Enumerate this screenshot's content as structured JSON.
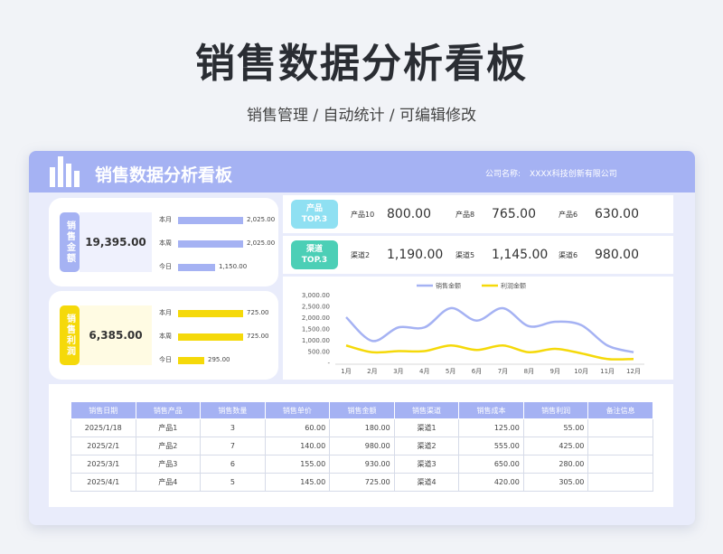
{
  "hero": {
    "title": "销售数据分析看板",
    "subtitle": "销售管理 / 自动统计 / 可编辑修改"
  },
  "header": {
    "title": "销售数据分析看板",
    "company_label": "公司名称:",
    "company_name": "XXXX科技创新有限公司",
    "logo_icon": "bar-chart-icon"
  },
  "kpis": [
    {
      "tag": "销售金额",
      "value": "19,395.00",
      "tag_color": "#a5b2f3",
      "box_color": "#eff1fd",
      "bar_color": "#a5b2f3",
      "bars": [
        {
          "label": "本月",
          "value": "2,025.00",
          "fraction": 1.0
        },
        {
          "label": "本周",
          "value": "2,025.00",
          "fraction": 1.0
        },
        {
          "label": "今日",
          "value": "1,150.00",
          "fraction": 0.568
        }
      ]
    },
    {
      "tag": "销售利润",
      "value": "6,385.00",
      "tag_color": "#f5d90a",
      "box_color": "#fffbe3",
      "bar_color": "#f5d90a",
      "bars": [
        {
          "label": "本月",
          "value": "725.00",
          "fraction": 1.0
        },
        {
          "label": "本周",
          "value": "725.00",
          "fraction": 1.0
        },
        {
          "label": "今日",
          "value": "295.00",
          "fraction": 0.407
        }
      ]
    }
  ],
  "rankings": [
    {
      "tag_line1": "产品",
      "tag_line2": "TOP.3",
      "tag_color": "#8fe0f2",
      "items": [
        {
          "name": "产品10",
          "value": "800.00"
        },
        {
          "name": "产品8",
          "value": "765.00"
        },
        {
          "name": "产品6",
          "value": "630.00"
        }
      ]
    },
    {
      "tag_line1": "渠道",
      "tag_line2": "TOP.3",
      "tag_color": "#4ccfb6",
      "items": [
        {
          "name": "渠道2",
          "value": "1,190.00"
        },
        {
          "name": "渠道5",
          "value": "1,145.00"
        },
        {
          "name": "渠道6",
          "value": "980.00"
        }
      ]
    }
  ],
  "chart_data": {
    "type": "line",
    "x": [
      "1月",
      "2月",
      "3月",
      "4月",
      "5月",
      "6月",
      "7月",
      "8月",
      "9月",
      "10月",
      "11月",
      "12月"
    ],
    "ylim": [
      0,
      3000
    ],
    "yticks": [
      "3,000.00",
      "2,500.00",
      "2,000.00",
      "1,500.00",
      "1,000.00",
      "500.00",
      "-"
    ],
    "legend": "top",
    "grid": false,
    "series": [
      {
        "name": "销售金额",
        "color": "#a5b2f3",
        "values": [
          2000,
          950,
          1550,
          1550,
          2400,
          1850,
          2400,
          1600,
          1800,
          1650,
          750,
          450
        ]
      },
      {
        "name": "利润金额",
        "color": "#f5d90a",
        "values": [
          750,
          450,
          500,
          500,
          750,
          550,
          750,
          450,
          600,
          400,
          150,
          150
        ]
      }
    ]
  },
  "table": {
    "headers": [
      "销售日期",
      "销售产品",
      "销售数量",
      "销售单价",
      "销售金额",
      "销售渠道",
      "销售成本",
      "销售利润",
      "备注信息"
    ],
    "rows": [
      [
        "2025/1/18",
        "产品1",
        "3",
        "60.00",
        "180.00",
        "渠道1",
        "125.00",
        "55.00",
        ""
      ],
      [
        "2025/2/1",
        "产品2",
        "7",
        "140.00",
        "980.00",
        "渠道2",
        "555.00",
        "425.00",
        ""
      ],
      [
        "2025/3/1",
        "产品3",
        "6",
        "155.00",
        "930.00",
        "渠道3",
        "650.00",
        "280.00",
        ""
      ],
      [
        "2025/4/1",
        "产品4",
        "5",
        "145.00",
        "725.00",
        "渠道4",
        "420.00",
        "305.00",
        ""
      ]
    ]
  }
}
